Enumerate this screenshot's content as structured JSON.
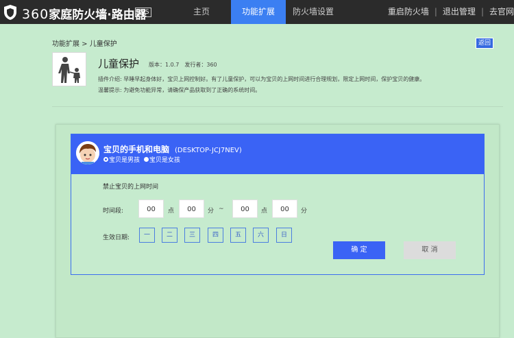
{
  "header": {
    "brand_prefix": "360",
    "brand_suffix": "家庭防火墙·路由器",
    "version_badge": "V5S",
    "nav": [
      {
        "label": "主页"
      },
      {
        "label": "功能扩展",
        "active": true
      },
      {
        "label": "防火墙设置"
      }
    ],
    "right_links": [
      "重启防火墙",
      "退出管理",
      "去官网"
    ],
    "accent_color": "#3b7ff2"
  },
  "breadcrumb": "功能扩展 > 儿童保护",
  "back_label": "返回",
  "app": {
    "icon": "child-protection-icon",
    "title": "儿童保护",
    "version": "版本：1.0.7",
    "publisher": "发行者：360",
    "description": "插件介绍:  早睡早起身体好，宝贝上网控制好。有了儿童保护，可以为宝贝的上网时间进行合理规划，限定上网时间，保护宝贝的健康。",
    "tip": "温馨提示: 为避免功能异常，请确保产品获取到了正确的系统时间。"
  },
  "device": {
    "avatar": "child-avatar-icon",
    "name": "宝贝的手机和电脑",
    "id": "(DESKTOP-JCJ7NEV)",
    "gender_options": [
      "宝贝是男孩",
      "宝贝是女孩"
    ],
    "gender_selected": "宝贝是男孩"
  },
  "schedule": {
    "title": "禁止宝贝的上网时间",
    "time_label": "时间段:",
    "start_hour": "00",
    "start_min": "00",
    "end_hour": "00",
    "end_min": "00",
    "unit_hour": "点",
    "unit_min": "分",
    "range_sep": "~",
    "days_label": "生效日期:",
    "days": [
      "一",
      "二",
      "三",
      "四",
      "五",
      "六",
      "日"
    ]
  },
  "actions": {
    "ok": "确 定",
    "cancel": "取 消"
  }
}
